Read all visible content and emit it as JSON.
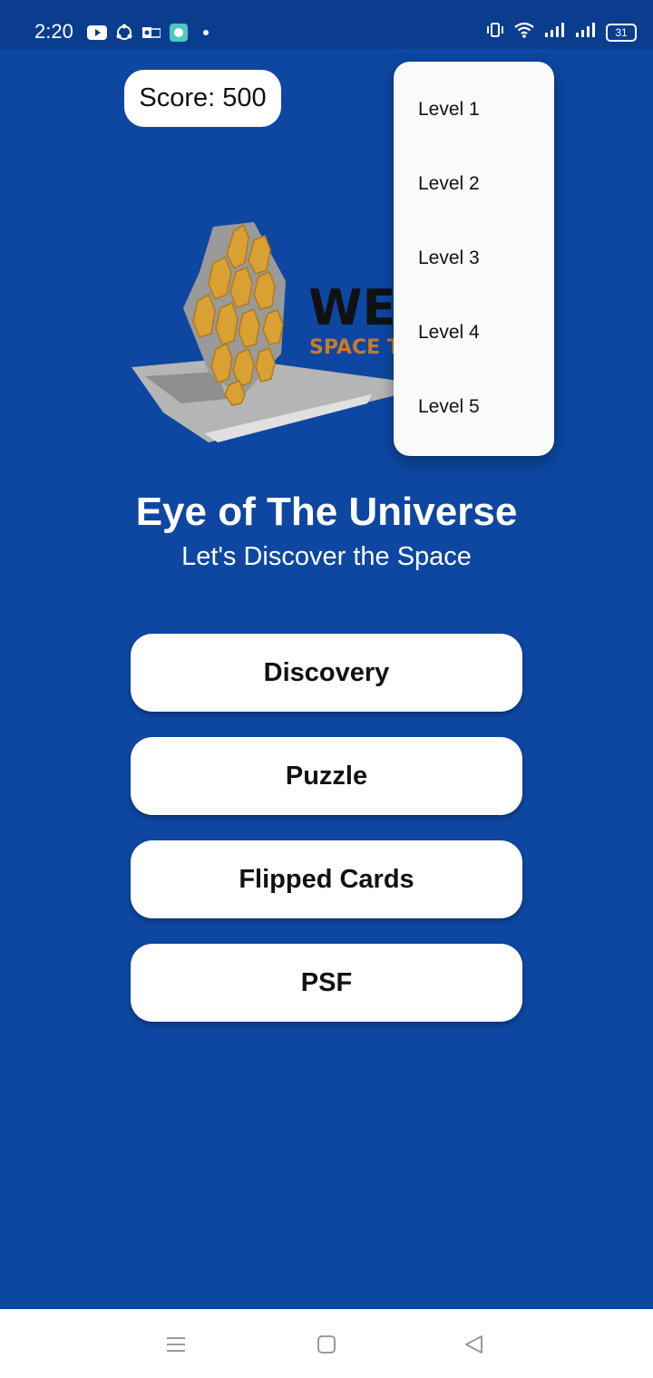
{
  "status_bar": {
    "time": "2:20",
    "battery": "31",
    "icons": [
      "youtube-icon",
      "share-sync-icon",
      "outlook-icon",
      "chat-app-icon",
      "dot-icon",
      "vibrate-icon",
      "wifi-icon",
      "signal-icon",
      "signal-icon",
      "battery-icon"
    ]
  },
  "score": {
    "label": "Score: 500"
  },
  "logo": {
    "text_main": "WEBB",
    "text_sub": "SPACE TELESCOPE",
    "colors": {
      "gold": "#d9a033",
      "grey": "#b5b5b5",
      "dark": "#111111",
      "orange": "#c97a2a"
    }
  },
  "dropdown": {
    "items": [
      "Level 1",
      "Level 2",
      "Level 3",
      "Level 4",
      "Level 5"
    ]
  },
  "title": "Eye of The Universe",
  "subtitle": "Let's Discover the Space",
  "menu": {
    "discovery": "Discovery",
    "puzzle": "Puzzle",
    "flipped_cards": "Flipped Cards",
    "psf": "PSF"
  },
  "nav": {
    "icons": [
      "menu-icon",
      "home-icon",
      "back-icon"
    ]
  },
  "colors": {
    "background": "#0d47a1",
    "status_bar": "#0b3d8f",
    "button": "#ffffff"
  }
}
